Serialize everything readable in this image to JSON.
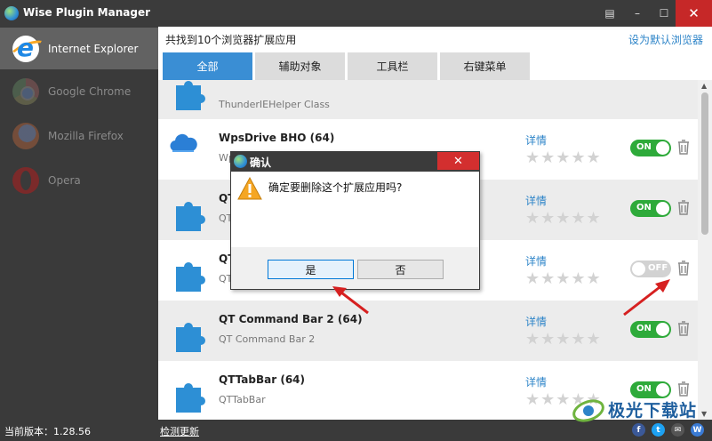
{
  "window": {
    "title": "Wise Plugin Manager",
    "menu_glyph": "▤",
    "min_glyph": "–",
    "max_glyph": "☐",
    "close_glyph": "✕"
  },
  "sidebar": {
    "browsers": [
      {
        "name": "Internet Explorer",
        "icon": "internet-explorer-icon",
        "active": true
      },
      {
        "name": "Google Chrome",
        "icon": "chrome-icon",
        "active": false
      },
      {
        "name": "Mozilla Firefox",
        "icon": "firefox-icon",
        "active": false
      },
      {
        "name": "Opera",
        "icon": "opera-icon",
        "active": false
      }
    ]
  },
  "main": {
    "found_text": "共找到10个浏览器扩展应用",
    "set_default_link": "设为默认浏览器",
    "tabs": [
      {
        "label": "全部",
        "active": true
      },
      {
        "label": "辅助对象",
        "active": false
      },
      {
        "label": "工具栏",
        "active": false
      },
      {
        "label": "右键菜单",
        "active": false
      }
    ],
    "extensions": [
      {
        "name": "",
        "desc": "ThunderIEHelper Class",
        "detail": "",
        "status": "",
        "icon": "puzzle-icon"
      },
      {
        "name": "WpsDrive BHO (64)",
        "desc": "Wp",
        "detail": "详情",
        "status": "ON",
        "icon": "cloud-icon"
      },
      {
        "name": "QT",
        "desc": "QT",
        "detail": "详情",
        "status": "ON",
        "icon": "puzzle-icon"
      },
      {
        "name": "QT",
        "desc": "QT",
        "detail": "详情",
        "status": "OFF",
        "icon": "puzzle-icon"
      },
      {
        "name": "QT Command Bar 2 (64)",
        "desc": "QT Command Bar 2",
        "detail": "详情",
        "status": "ON",
        "icon": "puzzle-icon"
      },
      {
        "name": "QTTabBar (64)",
        "desc": "QTTabBar",
        "detail": "详情",
        "status": "ON",
        "icon": "puzzle-icon"
      }
    ],
    "stars_glyph": "★★★★★"
  },
  "dialog": {
    "title": "确认",
    "message": "确定要删除这个扩展应用吗?",
    "yes_label": "是",
    "no_label": "否",
    "close_glyph": "✕"
  },
  "footer": {
    "version_text": "当前版本：1.28.56",
    "check_update": "检测更新",
    "social": [
      {
        "glyph": "f",
        "color": "#3b5998"
      },
      {
        "glyph": "t",
        "color": "#1da1f2"
      },
      {
        "glyph": "✉",
        "color": "#555555"
      },
      {
        "glyph": "W",
        "color": "#3a7bd5"
      }
    ]
  },
  "watermark": {
    "text": "极光下载站"
  },
  "colors": {
    "accent": "#3a8ed4",
    "toggle_on": "#2eaa3a",
    "toggle_off": "#d2d2d2",
    "close_red": "#c62828",
    "annotation_red": "#d62020"
  }
}
